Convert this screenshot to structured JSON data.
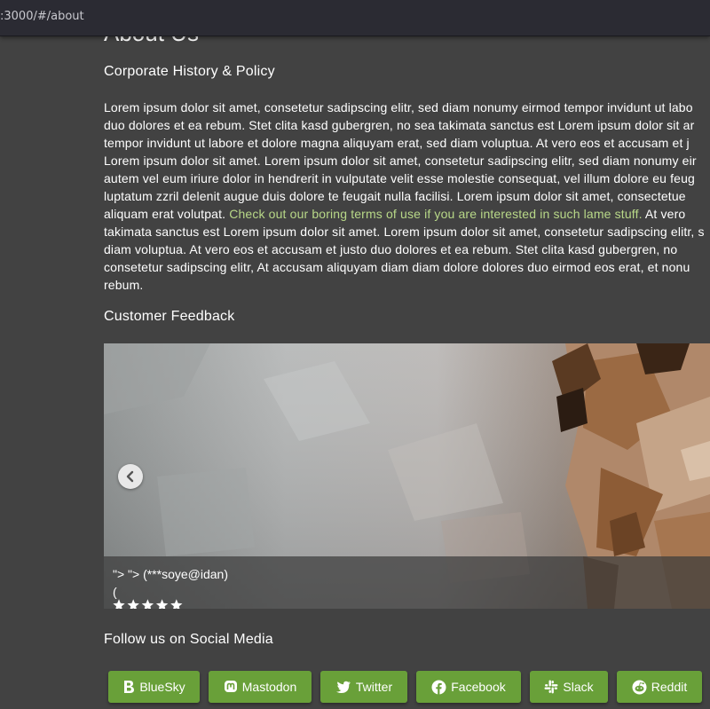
{
  "browser": {
    "url": ":3000/#/about"
  },
  "page": {
    "title": "About Us",
    "history_heading": "Corporate History & Policy",
    "history_lines": [
      "Lorem ipsum dolor sit amet, consetetur sadipscing elitr, sed diam nonumy eirmod tempor invidunt ut labo",
      "duo dolores et ea rebum. Stet clita kasd gubergren, no sea takimata sanctus est Lorem ipsum dolor sit ar",
      "tempor invidunt ut labore et dolore magna aliquyam erat, sed diam voluptua. At vero eos et accusam et j",
      "Lorem ipsum dolor sit amet. Lorem ipsum dolor sit amet, consetetur sadipscing elitr, sed diam nonumy eir",
      "autem vel eum iriure dolor in hendrerit in vulputate velit esse molestie consequat, vel illum dolore eu feug",
      "luptatum zzril delenit augue duis dolore te feugait nulla facilisi. Lorem ipsum dolor sit amet, consectetue"
    ],
    "history_line7_before": "aliquam erat volutpat. ",
    "history_link": "Check out our boring terms of use if you are interested in such lame stuff.",
    "history_line7_after": " At vero",
    "history_lines_after": [
      "takimata sanctus est Lorem ipsum dolor sit amet. Lorem ipsum dolor sit amet, consetetur sadipscing elitr, s",
      "diam voluptua. At vero eos et accusam et justo duo dolores et ea rebum. Stet clita kasd gubergren, no",
      "consetetur sadipscing elitr, At accusam aliquyam diam diam dolore dolores duo eirmod eos erat, et nonu",
      "rebum."
    ],
    "feedback_heading": "Customer Feedback",
    "feedback": {
      "author": "\"> \"> (***soye@idan)",
      "rating_open": "(",
      "rating_close": ")",
      "stars": 5
    },
    "social_heading": "Follow us on Social Media",
    "social_buttons": [
      {
        "label": "BlueSky",
        "icon": "bluesky-icon"
      },
      {
        "label": "Mastodon",
        "icon": "mastodon-icon"
      },
      {
        "label": "Twitter",
        "icon": "twitter-icon"
      },
      {
        "label": "Facebook",
        "icon": "facebook-icon"
      },
      {
        "label": "Slack",
        "icon": "slack-icon"
      },
      {
        "label": "Reddit",
        "icon": "reddit-icon"
      }
    ]
  },
  "colors": {
    "background": "#424242",
    "link": "#b8d888",
    "button": "#69a039"
  }
}
